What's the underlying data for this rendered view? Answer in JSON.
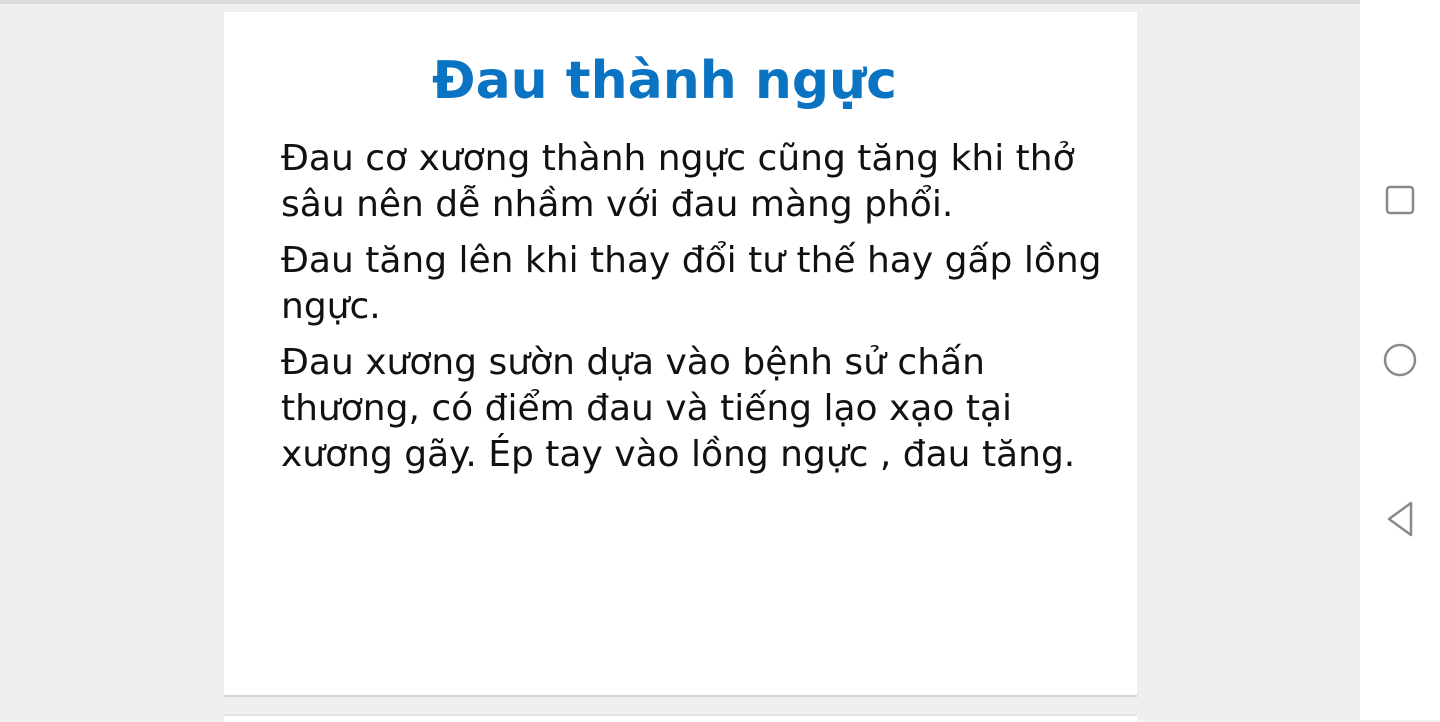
{
  "slide": {
    "title": "Đau thành ngực",
    "paragraphs": [
      "Đau cơ xương thành ngực cũng tăng khi thở sâu nên dễ nhầm với đau màng phổi.",
      "Đau tăng lên khi thay đổi tư thế hay gấp lồng ngực.",
      "Đau xương sườn dựa vào bệnh sử chấn thương, có điểm đau và tiếng lạo xạo tại xương gãy. Ép tay vào lồng ngực , đau tăng."
    ],
    "title_color": "#0a73c2",
    "text_color": "#111111"
  },
  "navigation_bar": {
    "icons": [
      "recents-icon",
      "home-icon",
      "back-icon"
    ],
    "icon_color": "#8a8a8a"
  }
}
